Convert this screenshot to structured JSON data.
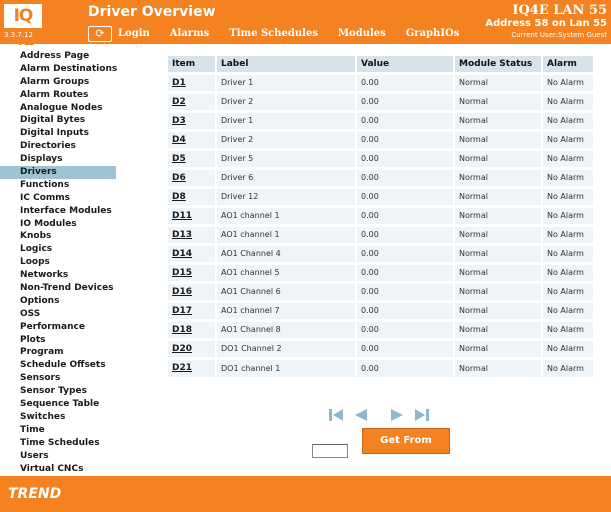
{
  "header": {
    "logo_text": "IQ 4E",
    "version": "3.3.7.12",
    "title": "Driver Overview",
    "nav": [
      "Login",
      "Alarms",
      "Time Schedules",
      "Modules",
      "GraphIOs"
    ],
    "device_name": "IQ4E LAN 55",
    "address": "Address 58 on Lan 55",
    "current_user": "Current User:System Guest"
  },
  "sidebar": {
    "items": [
      "Address Page",
      "Alarm Destinations",
      "Alarm Groups",
      "Alarm Routes",
      "Analogue Nodes",
      "Digital Bytes",
      "Digital Inputs",
      "Directories",
      "Displays",
      "Drivers",
      "Functions",
      "IC Comms",
      "Interface Modules",
      "IO Modules",
      "Knobs",
      "Logics",
      "Loops",
      "Networks",
      "Non-Trend Devices",
      "Options",
      "OSS",
      "Performance",
      "Plots",
      "Program",
      "Schedule Offsets",
      "Sensors",
      "Sensor Types",
      "Sequence Table",
      "Switches",
      "Time",
      "Time Schedules",
      "Users",
      "Virtual CNCs"
    ],
    "active": "Drivers"
  },
  "table": {
    "columns": [
      "Item",
      "Label",
      "Value",
      "Module Status",
      "Alarm"
    ],
    "rows": [
      {
        "item": "D1",
        "label": "Driver 1",
        "value": "0.00",
        "status": "Normal",
        "alarm": "No Alarm"
      },
      {
        "item": "D2",
        "label": "Driver 2",
        "value": "0.00",
        "status": "Normal",
        "alarm": "No Alarm"
      },
      {
        "item": "D3",
        "label": "Driver 1",
        "value": "0.00",
        "status": "Normal",
        "alarm": "No Alarm"
      },
      {
        "item": "D4",
        "label": "Driver 2",
        "value": "0.00",
        "status": "Normal",
        "alarm": "No Alarm"
      },
      {
        "item": "D5",
        "label": "Driver 5",
        "value": "0.00",
        "status": "Normal",
        "alarm": "No Alarm"
      },
      {
        "item": "D6",
        "label": "Driver 6",
        "value": "0.00",
        "status": "Normal",
        "alarm": "No Alarm"
      },
      {
        "item": "D8",
        "label": "Driver 12",
        "value": "0.00",
        "status": "Normal",
        "alarm": "No Alarm"
      },
      {
        "item": "D11",
        "label": "AO1 channel 1",
        "value": "0.00",
        "status": "Normal",
        "alarm": "No Alarm"
      },
      {
        "item": "D13",
        "label": "AO1 channel 1",
        "value": "0.00",
        "status": "Normal",
        "alarm": "No Alarm"
      },
      {
        "item": "D14",
        "label": "AO1 Channel 4",
        "value": "0.00",
        "status": "Normal",
        "alarm": "No Alarm"
      },
      {
        "item": "D15",
        "label": "AO1 channel 5",
        "value": "0.00",
        "status": "Normal",
        "alarm": "No Alarm"
      },
      {
        "item": "D16",
        "label": "AO1 Channel 6",
        "value": "0.00",
        "status": "Normal",
        "alarm": "No Alarm"
      },
      {
        "item": "D17",
        "label": "AO1 channel 7",
        "value": "0.00",
        "status": "Normal",
        "alarm": "No Alarm"
      },
      {
        "item": "D18",
        "label": "AO1 Channel 8",
        "value": "0.00",
        "status": "Normal",
        "alarm": "No Alarm"
      },
      {
        "item": "D20",
        "label": "DO1 Channel 2",
        "value": "0.00",
        "status": "Normal",
        "alarm": "No Alarm"
      },
      {
        "item": "D21",
        "label": "DO1 channel 1",
        "value": "0.00",
        "status": "Normal",
        "alarm": "No Alarm"
      }
    ]
  },
  "pager": {
    "get_from_label": "Get From",
    "page_input_value": ""
  },
  "footer": {
    "brand": "TREND"
  },
  "colors": {
    "accent": "#f58220",
    "active_sidebar": "#9fc3d2",
    "table_header": "#d6e3ea",
    "table_cell": "#eef4f8",
    "pager_icon": "#8fb8cb"
  }
}
